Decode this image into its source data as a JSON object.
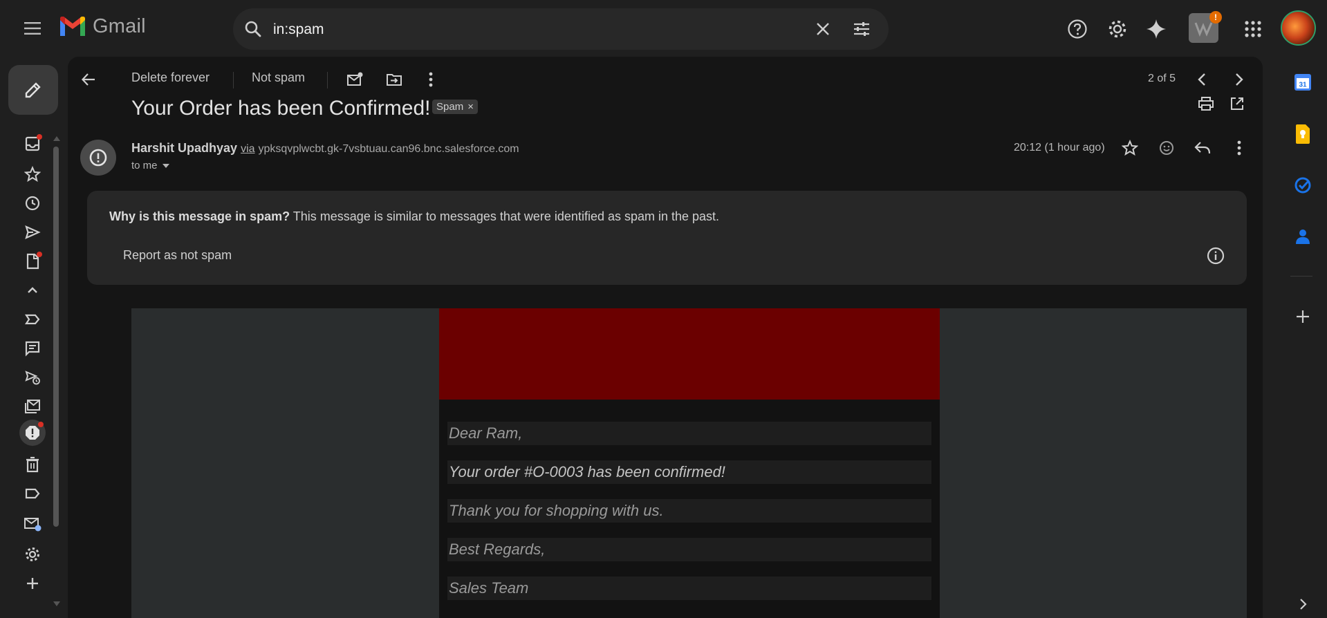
{
  "app": {
    "name": "Gmail",
    "brand_colors": {
      "red": "#ea4335",
      "blue": "#4285f4",
      "green": "#34a853",
      "yellow": "#fbbc04"
    }
  },
  "header": {
    "menu_icon": "menu-icon",
    "search": {
      "value": "in:spam",
      "icon": "search-icon",
      "clear_icon": "close-icon",
      "options_icon": "tune-icon"
    },
    "icons": [
      "help-icon",
      "gear-icon",
      "gemini-sparkle-icon",
      "apps-grid-icon"
    ],
    "brand_badge": "!"
  },
  "left_rail": {
    "compose_icon": "pencil-icon",
    "items": [
      {
        "name": "inbox",
        "icon": "inbox-icon",
        "dot": true
      },
      {
        "name": "starred",
        "icon": "star-icon",
        "dot": false
      },
      {
        "name": "snoozed",
        "icon": "clock-icon",
        "dot": false
      },
      {
        "name": "sent",
        "icon": "send-icon",
        "dot": false
      },
      {
        "name": "drafts",
        "icon": "draft-icon",
        "dot": true
      },
      {
        "name": "less",
        "icon": "chevron-up-icon",
        "dot": false
      },
      {
        "name": "important",
        "icon": "label-important-icon",
        "dot": false
      },
      {
        "name": "chats",
        "icon": "chat-icon",
        "dot": false
      },
      {
        "name": "scheduled",
        "icon": "scheduled-send-icon",
        "dot": false
      },
      {
        "name": "all-mail",
        "icon": "all-mail-icon",
        "dot": false
      },
      {
        "name": "spam",
        "icon": "spam-icon",
        "dot": true,
        "active": true
      },
      {
        "name": "trash",
        "icon": "trash-icon",
        "dot": false
      },
      {
        "name": "categories",
        "icon": "label-icon",
        "dot": false
      },
      {
        "name": "manage-subscriptions",
        "icon": "mail-settings-icon",
        "dot": false
      },
      {
        "name": "settings",
        "icon": "gear-icon",
        "dot": false
      },
      {
        "name": "create-label",
        "icon": "plus-icon",
        "dot": false
      }
    ]
  },
  "toolbar": {
    "delete_forever": "Delete forever",
    "not_spam": "Not spam",
    "pager": "2 of 5"
  },
  "message": {
    "subject": "Your Order has been Confirmed!",
    "label_chip": "Spam",
    "label_chip_close": "×",
    "sender_name": "Harshit Upadhyay",
    "via": "via",
    "sender_address": "ypksqvplwcbt.gk-7vsbtuau.can96.bnc.salesforce.com",
    "to": "to me",
    "time": "20:12 (1 hour ago)"
  },
  "spam_notice": {
    "question": "Why is this message in spam?",
    "explanation": "This message is similar to messages that were identified as spam in the past.",
    "report_label": "Report as not spam"
  },
  "email_body": {
    "banner_color": "#6b0000",
    "lines": [
      "Dear Ram,",
      "Your order #O-0003 has been confirmed!",
      "Thank you for shopping with us.",
      "Best Regards,",
      "Sales Team"
    ]
  },
  "side_panel": {
    "apps": [
      "calendar-icon",
      "keep-icon",
      "tasks-icon",
      "contacts-icon",
      "plus-icon"
    ],
    "calendar_day": "31"
  }
}
